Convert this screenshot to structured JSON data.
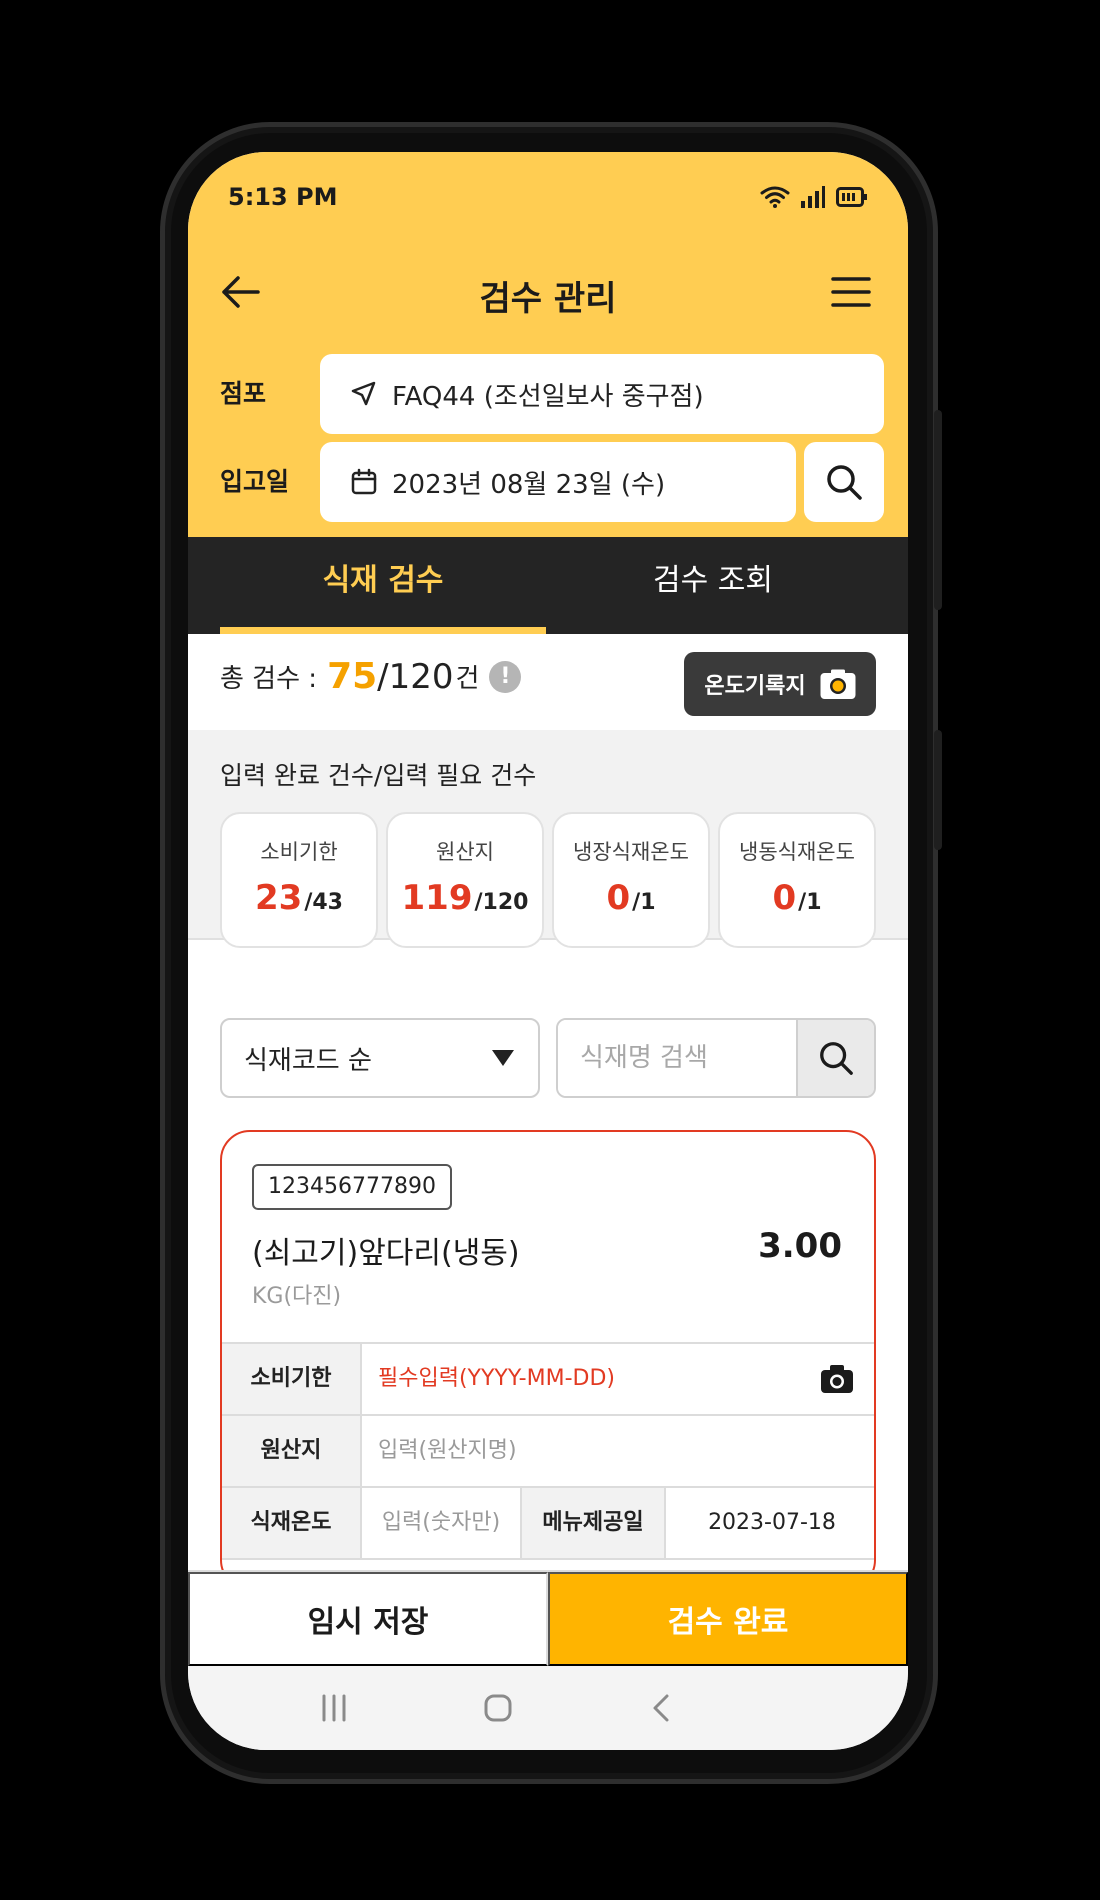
{
  "status": {
    "time": "5:13 PM"
  },
  "appbar": {
    "title": "검수 관리"
  },
  "filters": {
    "store_label": "점포",
    "store_value": "FAQ44 (조선일보사 중구점)",
    "date_label": "입고일",
    "date_value": "2023년 08월 23일 (수)"
  },
  "tabs": [
    {
      "label": "식재 검수"
    },
    {
      "label": "검수 조회"
    }
  ],
  "summary": {
    "label": "총 검수 :",
    "done": "75",
    "total": "/120",
    "unit": "건",
    "info": "!",
    "temp_button": "온도기록지"
  },
  "stats": {
    "title": "입력 완료 건수/입력 필요 건수",
    "cards": [
      {
        "label": "소비기한",
        "current": "23",
        "max": "/43"
      },
      {
        "label": "원산지",
        "current": "119",
        "max": "/120"
      },
      {
        "label": "냉장식재온도",
        "current": "0",
        "max": "/1"
      },
      {
        "label": "냉동식재온도",
        "current": "0",
        "max": "/1"
      }
    ]
  },
  "list_controls": {
    "sort_value": "식재코드 순",
    "search_placeholder": "식재명 검색"
  },
  "item": {
    "code": "123456777890",
    "name": "(쇠고기)앞다리(냉동)",
    "quantity": "3.00",
    "unit": "KG(다진)",
    "rows": {
      "expiry_label": "소비기한",
      "expiry_value": "필수입력(YYYY-MM-DD)",
      "origin_label": "원산지",
      "origin_value": "입력(원산지명)",
      "temp_label": "식재온도",
      "temp_value": "입력(숫자만)",
      "menu_label": "메뉴제공일",
      "menu_value": "2023-07-18"
    }
  },
  "bottom": {
    "save_label": "임시 저장",
    "done_label": "검수 완료"
  },
  "colors": {
    "brand_yellow": "#ffcd52",
    "accent_orange": "#f5a100",
    "alert_red": "#e23a22",
    "done_button": "#ffb400",
    "tab_bg": "#242424"
  }
}
